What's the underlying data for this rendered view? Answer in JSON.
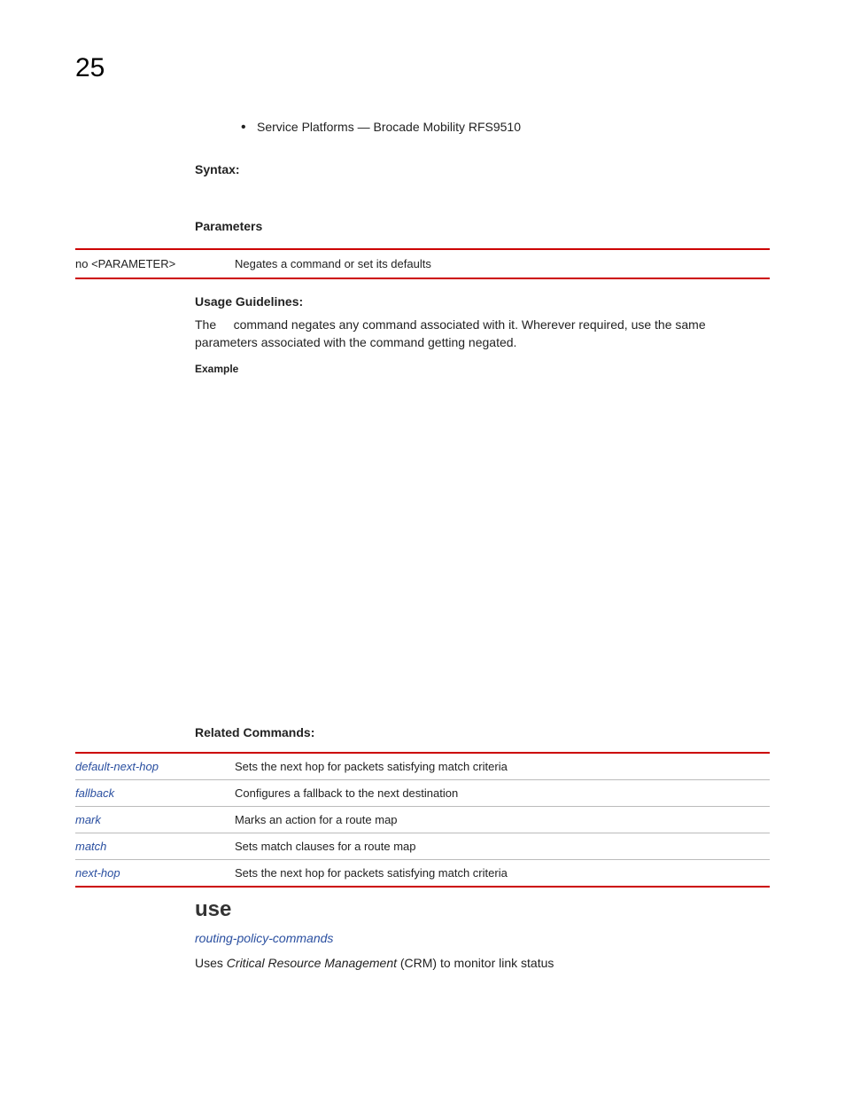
{
  "page_number": "25",
  "bullet_item": "Service Platforms — Brocade Mobility RFS9510",
  "syntax_heading": "Syntax:",
  "parameters_heading": "Parameters",
  "param_row": {
    "cmd": "no <PARAMETER>",
    "desc": "Negates a command or set its defaults"
  },
  "usage_heading": "Usage Guidelines:",
  "usage_text_prefix": "The",
  "usage_text_rest": "command negates any command associated with it. Wherever required, use the same parameters associated with the command getting negated.",
  "example_label": "Example",
  "related_heading": "Related Commands:",
  "related": [
    {
      "cmd": "default-next-hop",
      "desc": "Sets the next hop for packets satisfying match criteria"
    },
    {
      "cmd": "fallback",
      "desc": "Configures a fallback to the next destination"
    },
    {
      "cmd": "mark",
      "desc": "Marks an action for a route map"
    },
    {
      "cmd": "match",
      "desc": "Sets match clauses for a route map"
    },
    {
      "cmd": "next-hop",
      "desc": "Sets the next hop for packets satisfying match criteria"
    }
  ],
  "use_section": {
    "heading": "use",
    "breadcrumb": "routing-policy-commands",
    "desc_prefix": "Uses ",
    "desc_italic": "Critical Resource Management",
    "desc_suffix": " (CRM) to monitor link status"
  }
}
